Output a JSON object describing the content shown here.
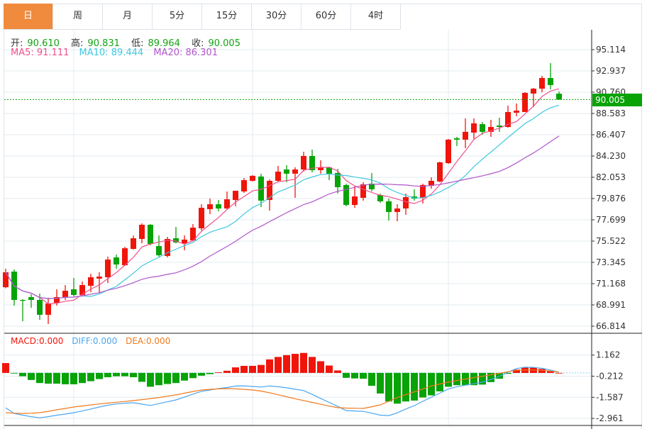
{
  "tabs": [
    {
      "label": "日",
      "active": true
    },
    {
      "label": "周"
    },
    {
      "label": "月"
    },
    {
      "label": "5分"
    },
    {
      "label": "15分"
    },
    {
      "label": "30分"
    },
    {
      "label": "60分"
    },
    {
      "label": "4时"
    }
  ],
  "ohlc_info": {
    "open_label": "开:",
    "open": "90.610",
    "high_label": "高:",
    "high": "90.831",
    "low_label": "低:",
    "low": "89.964",
    "close_label": "收:",
    "close": "90.005"
  },
  "ma_info": {
    "ma5": "MA5: 91.111",
    "ma10": "MA10: 89.444",
    "ma20": "MA20: 86.301"
  },
  "macd_info": {
    "macd": "MACD:0.000",
    "diff": "DIFF:0.000",
    "dea": "DEA:0.000"
  },
  "last_price": "90.005",
  "colors": {
    "up": "#f0150a",
    "down": "#07a307",
    "ma5": "#f0508c",
    "ma10": "#3ec8e0",
    "ma20": "#b055cc",
    "diff": "#4aa6f0",
    "dea": "#f07a1e",
    "active_tab": "#f08a3c"
  },
  "chart_data": [
    {
      "type": "candlestick",
      "ylim": [
        66.814,
        95.114
      ],
      "y_ticks": [
        "95.114",
        "92.937",
        "90.760",
        "88.583",
        "86.407",
        "84.230",
        "82.053",
        "79.876",
        "77.699",
        "75.522",
        "73.345",
        "71.168",
        "68.991",
        "66.814"
      ],
      "grid": true,
      "ohlc": [
        [
          70.8,
          72.69,
          70.7,
          72.33
        ],
        [
          72.4,
          72.62,
          68.92,
          69.5
        ],
        [
          69.5,
          69.57,
          67.32,
          69.43
        ],
        [
          69.79,
          70.08,
          68.7,
          69.5
        ],
        [
          69.5,
          70.15,
          67.47,
          67.98
        ],
        [
          67.98,
          69.72,
          67.03,
          69.14
        ],
        [
          69.21,
          70.59,
          68.92,
          69.79
        ],
        [
          69.79,
          71.02,
          69.5,
          70.44
        ],
        [
          70.59,
          71.75,
          69.86,
          70.01
        ],
        [
          70.01,
          71.39,
          69.93,
          71.02
        ],
        [
          70.95,
          72.18,
          70.3,
          71.82
        ],
        [
          71.68,
          72.33,
          70.22,
          71.89
        ],
        [
          71.82,
          73.92,
          71.24,
          73.63
        ],
        [
          73.85,
          74.14,
          72.69,
          73.13
        ],
        [
          73.05,
          74.94,
          72.98,
          74.79
        ],
        [
          74.72,
          76.1,
          74.65,
          75.81
        ],
        [
          75.74,
          77.34,
          75.3,
          77.19
        ],
        [
          77.19,
          77.26,
          75.09,
          75.23
        ],
        [
          75.01,
          76.1,
          73.92,
          74.07
        ],
        [
          74.0,
          75.96,
          73.85,
          75.74
        ],
        [
          75.81,
          76.97,
          75.3,
          75.38
        ],
        [
          75.3,
          76.1,
          74.58,
          75.67
        ],
        [
          75.59,
          77.26,
          75.52,
          76.9
        ],
        [
          76.83,
          79.29,
          76.61,
          78.93
        ],
        [
          78.79,
          79.87,
          78.28,
          79.29
        ],
        [
          79.29,
          79.73,
          78.57,
          78.86
        ],
        [
          78.86,
          80.6,
          78.79,
          79.8
        ],
        [
          79.73,
          80.67,
          79.08,
          80.67
        ],
        [
          80.6,
          81.98,
          80.46,
          81.76
        ],
        [
          81.69,
          82.27,
          81.62,
          82.2
        ],
        [
          82.13,
          82.42,
          79.0,
          79.66
        ],
        [
          79.73,
          81.83,
          78.64,
          81.69
        ],
        [
          81.69,
          83.21,
          81.54,
          82.63
        ],
        [
          82.85,
          83.29,
          81.54,
          82.42
        ],
        [
          82.42,
          83.07,
          79.95,
          82.85
        ],
        [
          82.85,
          84.66,
          82.63,
          84.23
        ],
        [
          84.23,
          84.88,
          82.56,
          82.78
        ],
        [
          82.78,
          83.79,
          82.42,
          83.07
        ],
        [
          83.07,
          83.14,
          81.76,
          82.42
        ],
        [
          82.49,
          82.92,
          80.39,
          81.04
        ],
        [
          81.26,
          81.4,
          79.08,
          79.22
        ],
        [
          79.22,
          81.11,
          78.93,
          80.09
        ],
        [
          79.95,
          81.54,
          79.66,
          81.33
        ],
        [
          81.4,
          82.49,
          80.6,
          80.82
        ],
        [
          80.24,
          80.38,
          79.44,
          79.59
        ],
        [
          79.59,
          79.87,
          77.63,
          78.5
        ],
        [
          78.5,
          79.29,
          77.55,
          78.86
        ],
        [
          78.86,
          80.38,
          78.21,
          80.02
        ],
        [
          80.09,
          80.82,
          79.66,
          79.87
        ],
        [
          79.95,
          81.4,
          79.37,
          81.26
        ],
        [
          81.18,
          82.05,
          80.89,
          81.69
        ],
        [
          81.62,
          83.65,
          81.54,
          83.58
        ],
        [
          83.5,
          85.97,
          83.43,
          85.9
        ],
        [
          86.04,
          86.19,
          85.24,
          85.9
        ],
        [
          85.9,
          88.08,
          85.03,
          86.7
        ],
        [
          86.62,
          88.08,
          85.97,
          87.57
        ],
        [
          87.49,
          87.71,
          86.41,
          86.7
        ],
        [
          86.7,
          87.93,
          86.19,
          87.2
        ],
        [
          87.35,
          88.15,
          86.7,
          87.2
        ],
        [
          87.2,
          89.38,
          87.13,
          88.73
        ],
        [
          88.66,
          89.6,
          88.29,
          88.87
        ],
        [
          88.73,
          90.76,
          88.73,
          90.69
        ],
        [
          90.62,
          91.2,
          89.24,
          91.12
        ],
        [
          91.12,
          92.43,
          90.76,
          92.21
        ],
        [
          92.21,
          93.73,
          91.05,
          91.49
        ],
        [
          90.61,
          90.831,
          89.964,
          90.005
        ]
      ],
      "moving_averages": [
        "MA5",
        "MA10",
        "MA20"
      ]
    },
    {
      "type": "macd",
      "ylim": [
        -3.42,
        2.58
      ],
      "y_ticks": [
        "1.162",
        "-0.212",
        "-1.587",
        "-2.961"
      ],
      "diff": [
        -2.27,
        -2.64,
        -2.75,
        -2.85,
        -2.92,
        -2.85,
        -2.75,
        -2.68,
        -2.59,
        -2.48,
        -2.35,
        -2.22,
        -2.1,
        -2.02,
        -1.97,
        -1.94,
        -2.03,
        -2.12,
        -2.0,
        -1.88,
        -1.76,
        -1.57,
        -1.38,
        -1.2,
        -1.11,
        -1.02,
        -0.95,
        -0.86,
        -0.84,
        -0.88,
        -0.92,
        -0.85,
        -0.9,
        -0.97,
        -1.06,
        -1.15,
        -1.4,
        -1.66,
        -1.92,
        -2.18,
        -2.45,
        -2.48,
        -2.5,
        -2.62,
        -2.75,
        -2.78,
        -2.6,
        -2.35,
        -2.13,
        -1.85,
        -1.58,
        -1.32,
        -1.05,
        -0.9,
        -0.8,
        -0.7,
        -0.6,
        -0.42,
        -0.22,
        0.05,
        0.28,
        0.37,
        0.36,
        0.3,
        0.18,
        0.05
      ],
      "dea": [
        -2.59,
        -2.62,
        -2.64,
        -2.62,
        -2.59,
        -2.5,
        -2.4,
        -2.31,
        -2.22,
        -2.15,
        -2.08,
        -2.02,
        -1.96,
        -1.91,
        -1.86,
        -1.8,
        -1.74,
        -1.67,
        -1.6,
        -1.52,
        -1.43,
        -1.32,
        -1.21,
        -1.11,
        -1.07,
        -1.04,
        -1.02,
        -1.04,
        -1.07,
        -1.11,
        -1.18,
        -1.29,
        -1.42,
        -1.55,
        -1.68,
        -1.8,
        -1.92,
        -2.04,
        -2.16,
        -2.26,
        -2.29,
        -2.3,
        -2.31,
        -2.2,
        -2.08,
        -1.85,
        -1.6,
        -1.42,
        -1.23,
        -1.05,
        -0.85,
        -0.72,
        -0.6,
        -0.5,
        -0.4,
        -0.3,
        -0.22,
        -0.12,
        -0.03,
        0.08,
        0.17,
        0.19,
        0.19,
        0.17,
        0.12,
        0.05
      ]
    }
  ]
}
